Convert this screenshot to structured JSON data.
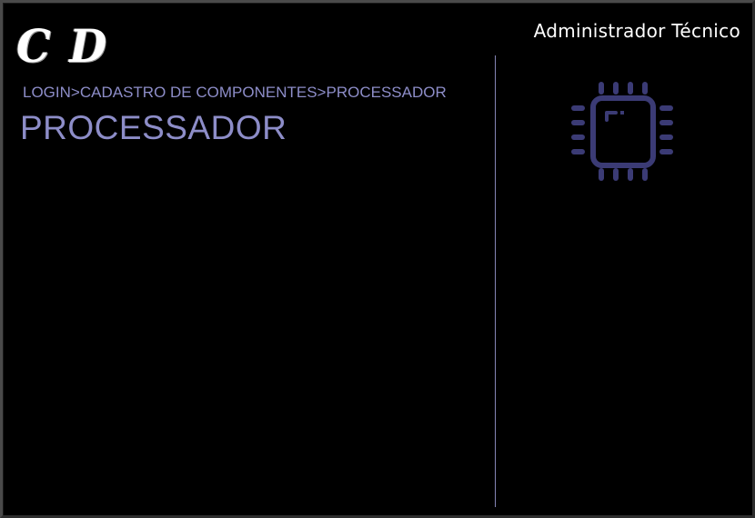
{
  "header": {
    "logo_letters": [
      "C",
      "D"
    ],
    "user_role": "Administrador Técnico"
  },
  "breadcrumb": {
    "items": [
      "LOGIN",
      "CADASTRO DE COMPONENTES",
      "PROCESSADOR"
    ],
    "separator": ">"
  },
  "page": {
    "title": "PROCESSADOR"
  },
  "side_panel": {
    "icon": "cpu-chip-icon"
  },
  "colors": {
    "background": "#000000",
    "accent_text": "#8d8dc8",
    "icon": "#3b3b75",
    "divider": "#8585b5",
    "header_text": "#ffffff"
  }
}
